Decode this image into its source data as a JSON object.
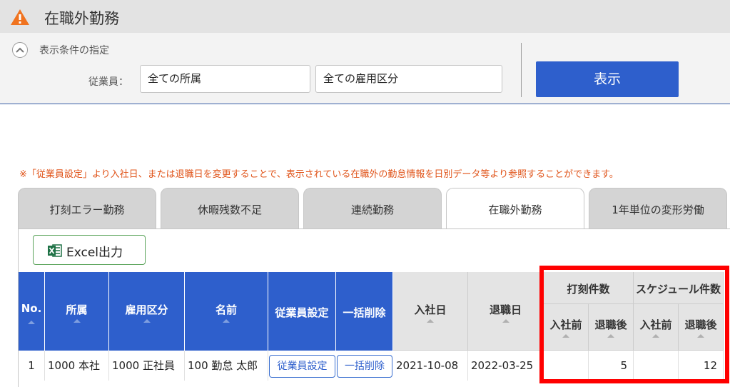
{
  "header": {
    "title": "在職外勤務",
    "icon": "warning-icon",
    "icon_color": "#f0731f"
  },
  "filters": {
    "heading": "表示条件の指定",
    "employee_label": "従業員：",
    "affiliation_value": "全ての所属",
    "employment_type_value": "全ての雇用区分",
    "show_button": "表示"
  },
  "notice": "※「従業員設定」より入社日、または退職日を変更することで、表示されている在職外の勤怠情報を日別データ等より参照することができます。",
  "tabs": [
    {
      "label": "打刻エラー勤務",
      "active": false
    },
    {
      "label": "休暇残数不足",
      "active": false
    },
    {
      "label": "連続勤務",
      "active": false
    },
    {
      "label": "在職外勤務",
      "active": true
    },
    {
      "label": "1年単位の変形労働",
      "active": false
    }
  ],
  "toolbar": {
    "excel_label": "Excel出力",
    "excel_icon": "excel-icon"
  },
  "table": {
    "headers": {
      "no": "No.",
      "affiliation": "所属",
      "employment_type": "雇用区分",
      "name": "名前",
      "employee_settings": "従業員設定",
      "bulk_delete": "一括削除",
      "hire_date": "入社日",
      "retire_date": "退職日",
      "punch_count": "打刻件数",
      "schedule_count": "スケジュール件数",
      "before_hire": "入社前",
      "after_retire": "退職後"
    },
    "rows": [
      {
        "no": "1",
        "affiliation": "1000 本社",
        "employment_type": "1000 正社員",
        "name": "100 勤怠 太郎",
        "employee_settings_button": "従業員設定",
        "bulk_delete_button": "一括削除",
        "hire_date": "2021-10-08",
        "retire_date": "2022-03-25",
        "punch_before": "",
        "punch_after": "5",
        "schedule_before": "",
        "schedule_after": "12"
      }
    ]
  },
  "colors": {
    "primary": "#2e5fcc",
    "notice": "#e0541a",
    "highlight": "#ff0000"
  }
}
